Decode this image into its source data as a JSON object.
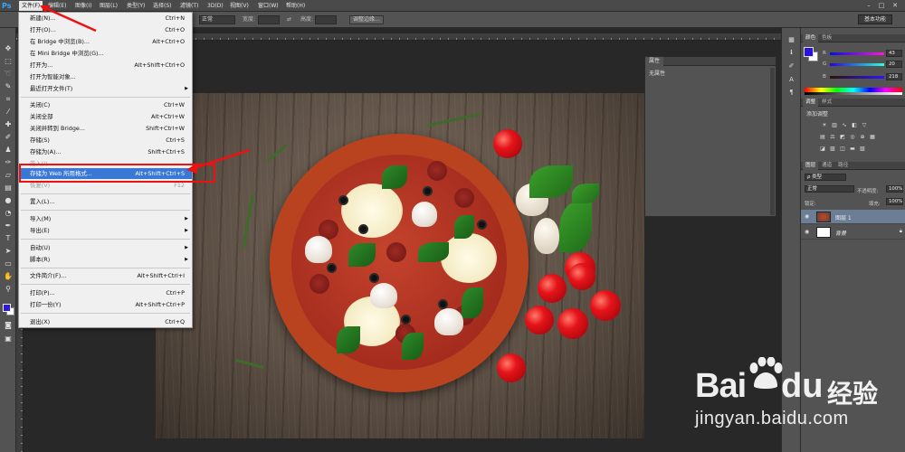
{
  "app": {
    "logo": "Ps",
    "menus": [
      "文件(F)",
      "编辑(E)",
      "图像(I)",
      "图层(L)",
      "类型(Y)",
      "选择(S)",
      "滤镜(T)",
      "3D(D)",
      "视图(V)",
      "窗口(W)",
      "帮助(H)"
    ],
    "window_buttons": [
      "–",
      "□",
      "✕"
    ]
  },
  "options_bar": {
    "mode_value": "正常",
    "opacity_label": "宽度:",
    "height_label": "高度:",
    "refine_button": "调整边缘...",
    "workspace": "基本功能"
  },
  "file_menu": {
    "items": [
      {
        "label": "新建(N)...",
        "shortcut": "Ctrl+N"
      },
      {
        "label": "打开(O)...",
        "shortcut": "Ctrl+O"
      },
      {
        "label": "在 Bridge 中浏览(B)...",
        "shortcut": "Alt+Ctrl+O"
      },
      {
        "label": "在 Mini Bridge 中浏览(G)...",
        "shortcut": ""
      },
      {
        "label": "打开为...",
        "shortcut": "Alt+Shift+Ctrl+O"
      },
      {
        "label": "打开为智能对象...",
        "shortcut": ""
      },
      {
        "label": "最近打开文件(T)",
        "shortcut": ""
      },
      {
        "label": "关闭(C)",
        "shortcut": "Ctrl+W"
      },
      {
        "label": "关闭全部",
        "shortcut": "Alt+Ctrl+W"
      },
      {
        "label": "关闭并转到 Bridge...",
        "shortcut": "Shift+Ctrl+W"
      },
      {
        "label": "存储(S)",
        "shortcut": "Ctrl+S"
      },
      {
        "label": "存储为(A)...",
        "shortcut": "Shift+Ctrl+S"
      },
      {
        "label": "签入(I)...",
        "shortcut": ""
      },
      {
        "label": "存储为 Web 所用格式...",
        "shortcut": "Alt+Shift+Ctrl+S"
      },
      {
        "label": "恢复(V)",
        "shortcut": "F12"
      },
      {
        "label": "置入(L)...",
        "shortcut": ""
      },
      {
        "label": "导入(M)",
        "shortcut": ""
      },
      {
        "label": "导出(E)",
        "shortcut": ""
      },
      {
        "label": "自动(U)",
        "shortcut": ""
      },
      {
        "label": "脚本(R)",
        "shortcut": ""
      },
      {
        "label": "文件简介(F)...",
        "shortcut": "Alt+Shift+Ctrl+I"
      },
      {
        "label": "打印(P)...",
        "shortcut": "Ctrl+P"
      },
      {
        "label": "打印一份(Y)",
        "shortcut": "Alt+Shift+Ctrl+P"
      },
      {
        "label": "退出(X)",
        "shortcut": "Ctrl+Q"
      }
    ]
  },
  "properties_panel": {
    "tab": "属性",
    "empty_text": "无属性"
  },
  "color_panel": {
    "tabs": [
      "颜色",
      "色板"
    ],
    "channels": [
      {
        "label": "R",
        "value": "43"
      },
      {
        "label": "G",
        "value": "20"
      },
      {
        "label": "B",
        "value": "218"
      }
    ],
    "foreground": "#2b14da"
  },
  "adjustments_panel": {
    "tabs": [
      "调整",
      "样式"
    ],
    "title": "添加调整"
  },
  "layers_panel": {
    "tabs": [
      "图层",
      "通道",
      "路径"
    ],
    "filter_label": "类型",
    "blend_mode": "正常",
    "opacity_label": "不透明度:",
    "opacity_value": "100%",
    "lock_label": "锁定:",
    "fill_label": "填充:",
    "fill_value": "100%",
    "layers": [
      {
        "name": "图层 1",
        "selected": true
      },
      {
        "name": "背景",
        "selected": false
      }
    ]
  },
  "watermark": {
    "brand_bai": "Bai",
    "brand_du": "du",
    "brand_cn": "经验",
    "url": "jingyan.baidu.com"
  }
}
